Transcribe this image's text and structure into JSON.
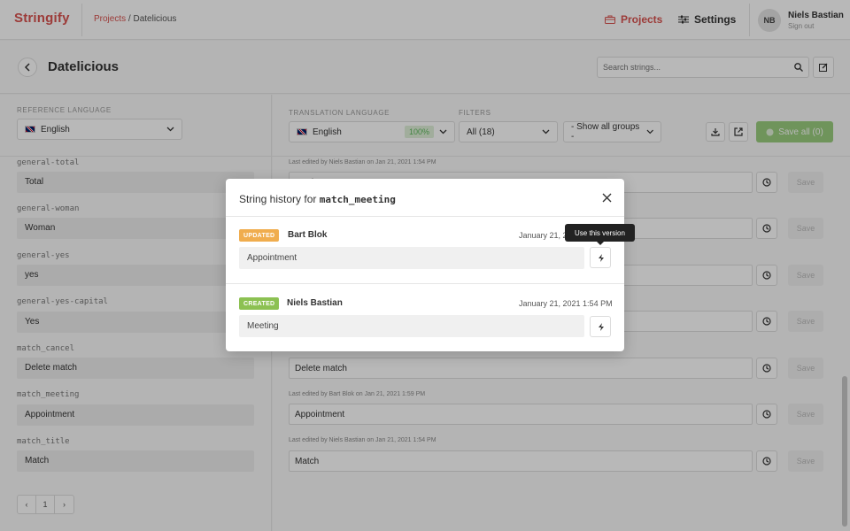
{
  "app": {
    "logo": "Stringify"
  },
  "breadcrumb": {
    "projects": "Projects",
    "sep": "/",
    "project": "Datelicious"
  },
  "nav": {
    "projects": "Projects",
    "settings": "Settings"
  },
  "user": {
    "initials": "NB",
    "name": "Niels Bastian",
    "signout": "Sign out"
  },
  "page": {
    "title": "Datelicious"
  },
  "search": {
    "placeholder": "Search strings..."
  },
  "reference": {
    "label": "REFERENCE LANGUAGE",
    "language": "English"
  },
  "translation": {
    "label": "TRANSLATION LANGUAGE",
    "language": "English",
    "progress": "100%"
  },
  "filters": {
    "label": "FILTERS",
    "status": "All (18)",
    "groups": "- Show all groups -"
  },
  "save_all": "Save all (0)",
  "rows": [
    {
      "key": "general-total",
      "ref": "Total",
      "edited": "Last edited by Niels Bastian on Jan 21, 2021 1:54 PM",
      "value": "Total",
      "save": "Save"
    },
    {
      "key": "general-woman",
      "ref": "Woman",
      "edited": "",
      "value": "",
      "save": "Save"
    },
    {
      "key": "general-yes",
      "ref": "yes",
      "edited": "",
      "value": "",
      "save": "Save"
    },
    {
      "key": "general-yes-capital",
      "ref": "Yes",
      "edited": "",
      "value": "",
      "save": "Save"
    },
    {
      "key": "match_cancel",
      "ref": "Delete match",
      "edited": "",
      "value": "Delete match",
      "save": "Save"
    },
    {
      "key": "match_meeting",
      "ref": "Appointment",
      "edited": "Last edited by Bart Blok on Jan 21, 2021 1:59 PM",
      "value": "Appointment",
      "save": "Save"
    },
    {
      "key": "match_title",
      "ref": "Match",
      "edited": "Last edited by Niels Bastian on Jan 21, 2021 1:54 PM",
      "value": "Match",
      "save": "Save"
    }
  ],
  "pager": {
    "prev": "‹",
    "page": "1",
    "next": "›"
  },
  "modal": {
    "title": "String history for",
    "key": "match_meeting",
    "entries": [
      {
        "badge": "UPDATED",
        "author": "Bart Blok",
        "date": "January 21, 2",
        "value": "Appointment"
      },
      {
        "badge": "CREATED",
        "author": "Niels Bastian",
        "date": "January 21, 2021 1:54 PM",
        "value": "Meeting"
      }
    ],
    "tooltip": "Use this version"
  },
  "colors": {
    "brand": "#d9534f",
    "success": "#8cc152",
    "warning": "#f0ad4e"
  }
}
